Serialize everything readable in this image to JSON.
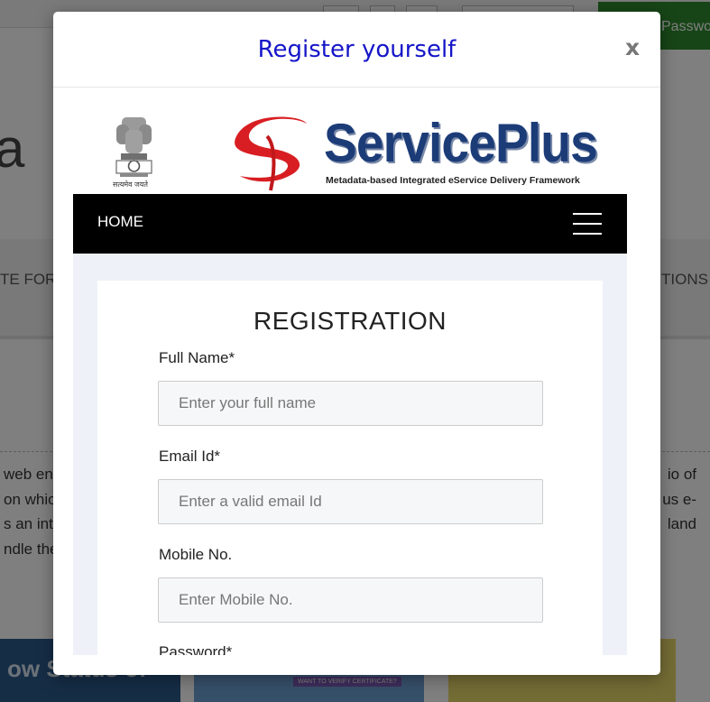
{
  "background": {
    "topbar_button_text": "Passwo",
    "big_letter": "a",
    "nav_left": "TE FOR .",
    "nav_right": "TIONS",
    "left_lines": [
      "web en",
      "on which",
      "s an int",
      "ndle the"
    ],
    "right_lines": [
      "io of",
      "us e-",
      "land"
    ],
    "tile_text": "ow Status of",
    "tile_badge": "WANT TO VERIFY CERTIFICATE?"
  },
  "modal": {
    "title": "Register yourself",
    "close_label": "x"
  },
  "site": {
    "emblem_caption": "सत्यमेव जयते",
    "logo_name": "ServicePlus",
    "tagline": "Metadata-based Integrated eService Delivery Framework",
    "nav_home": "HOME"
  },
  "form": {
    "title": "REGISTRATION",
    "fields": [
      {
        "label": "Full Name*",
        "placeholder": "Enter your full name",
        "value": ""
      },
      {
        "label": "Email Id*",
        "placeholder": "Enter a valid email Id",
        "value": ""
      },
      {
        "label": "Mobile No.",
        "placeholder": "Enter Mobile No.",
        "value": ""
      },
      {
        "label": "Password*",
        "placeholder": "",
        "value": ""
      }
    ]
  },
  "colors": {
    "modal_title": "#1515c8",
    "navbar": "#000000",
    "logo_blue": "#1c3c78",
    "logo_red": "#d81e22",
    "green_button": "#2e8b2e"
  }
}
